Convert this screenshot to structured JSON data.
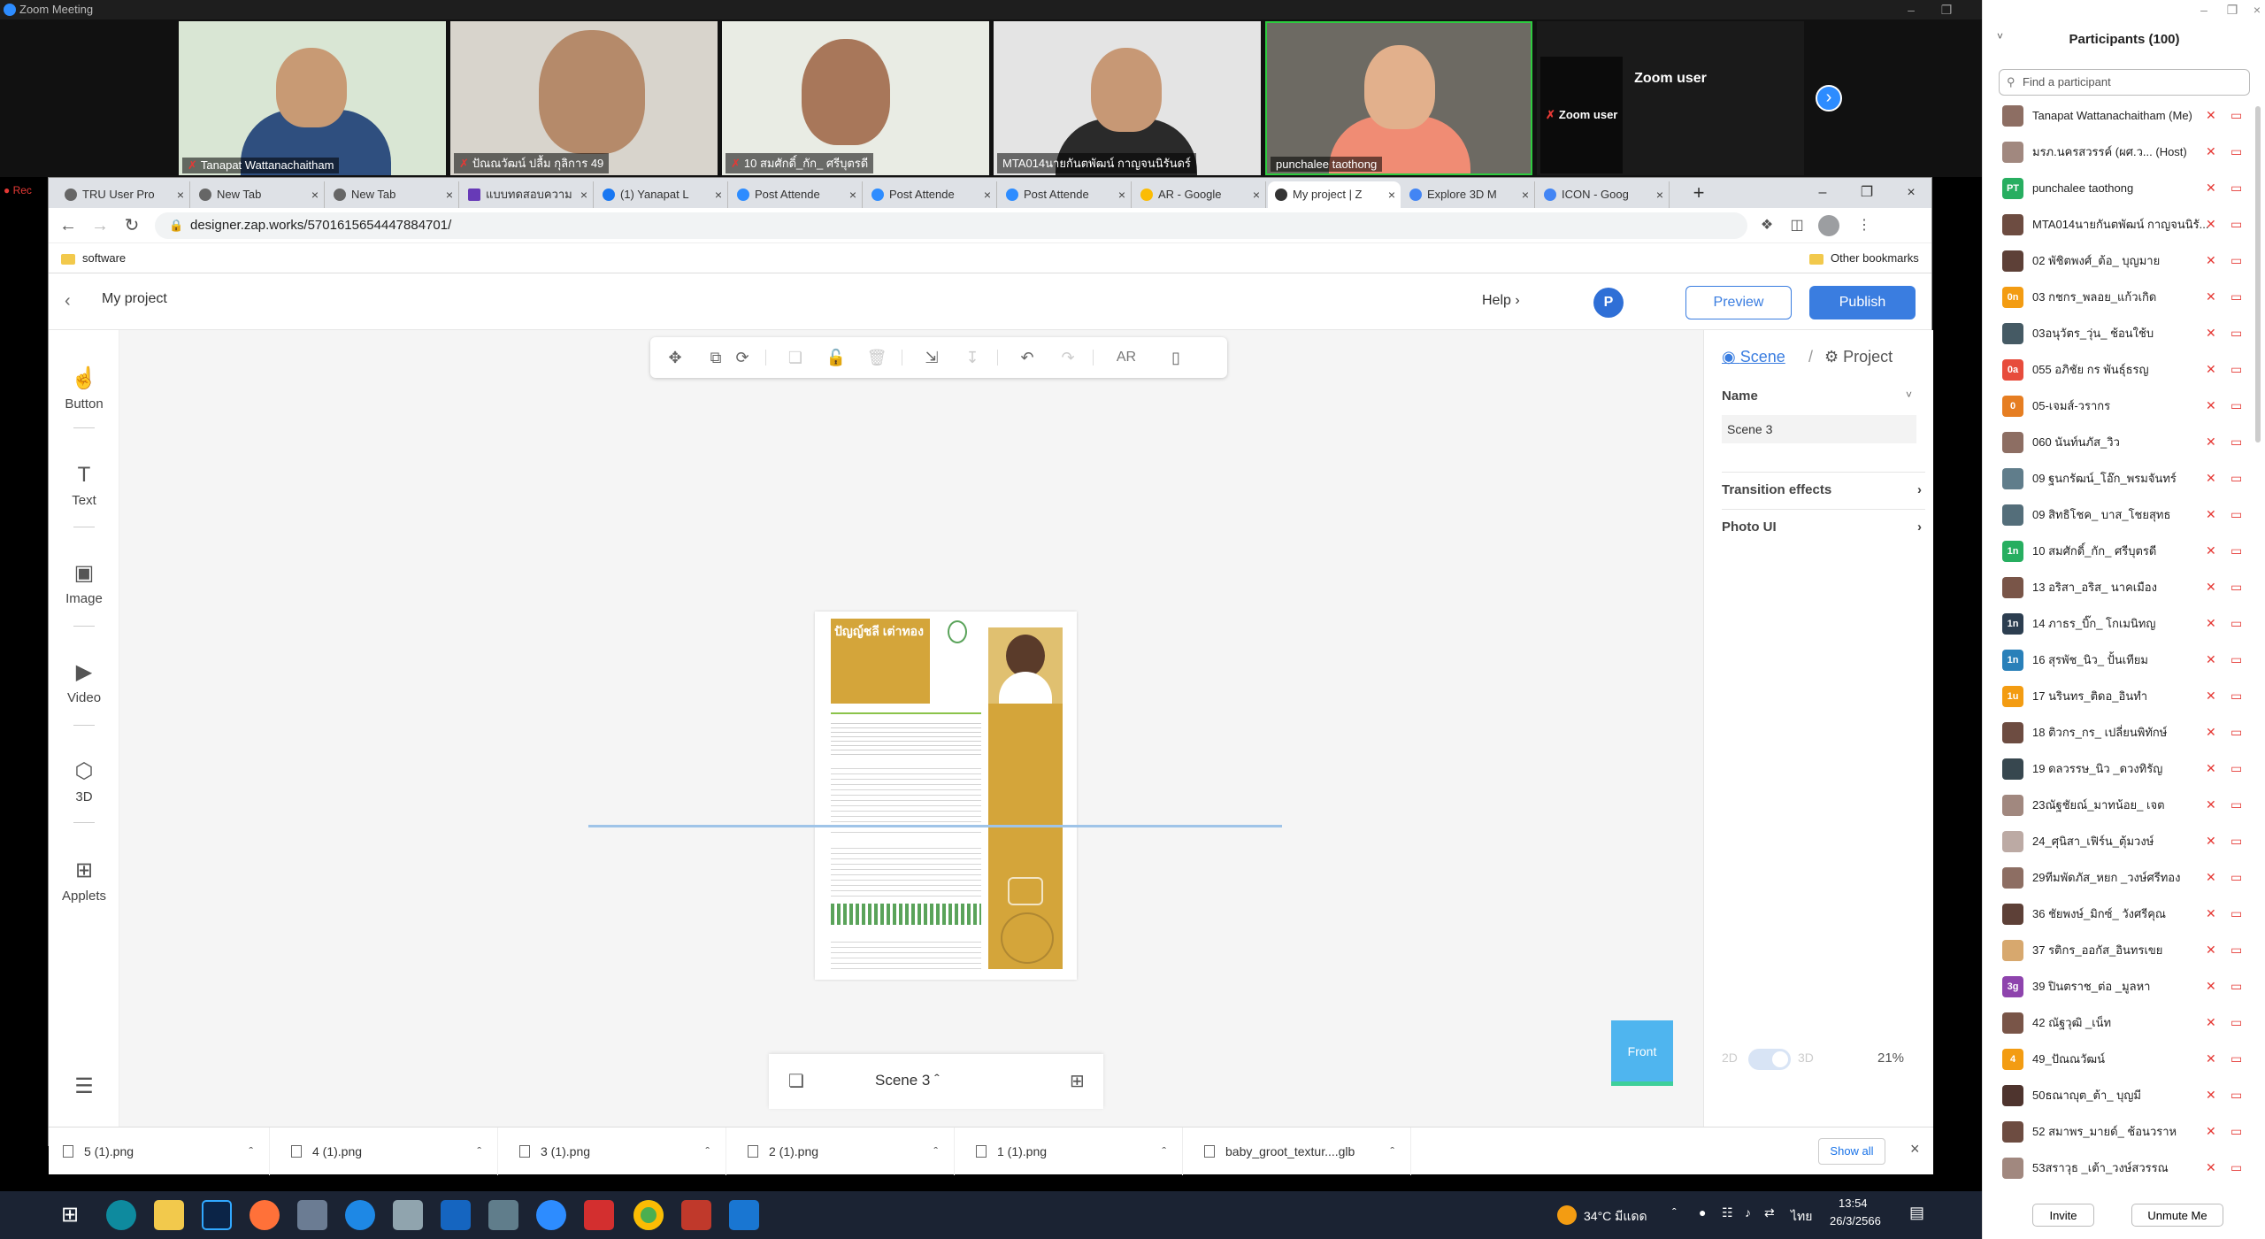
{
  "zoom": {
    "window_title": "Zoom Meeting",
    "recording_label": "Rec",
    "video_tiles": [
      {
        "name": "Tanapat Wattanachaitham"
      },
      {
        "name": "ปัณณวัฒน์ ปลื้ม กุลิการ 49"
      },
      {
        "name": "10 สมศักดิ์_กัก_ ศรีบุตรดี"
      },
      {
        "name": "MTA014นายกันตพัฒน์ กาญจนนิรันดร์"
      },
      {
        "name": "punchalee taothong"
      },
      {
        "name": "Zoom user"
      }
    ],
    "zoom_user_big": "Zoom user"
  },
  "browser": {
    "tabs": [
      {
        "label": "TRU User Pro"
      },
      {
        "label": "New Tab"
      },
      {
        "label": "New Tab"
      },
      {
        "label": "แบบทดสอบความ"
      },
      {
        "label": "(1) Yanapat L"
      },
      {
        "label": "Post Attende"
      },
      {
        "label": "Post Attende"
      },
      {
        "label": "Post Attende"
      },
      {
        "label": "AR - Google"
      },
      {
        "label": "My project | Z"
      },
      {
        "label": "Explore 3D M"
      },
      {
        "label": "ICON - Goog"
      }
    ],
    "url": "designer.zap.works/5701615654447884701/",
    "bookmarks": {
      "left": "software",
      "right": "Other bookmarks"
    }
  },
  "app": {
    "project_title": "My project",
    "help": "Help",
    "avatar_letter": "P",
    "preview": "Preview",
    "publish": "Publish",
    "rail": [
      {
        "label": "Button",
        "icon": "hand-pointer-icon"
      },
      {
        "label": "Text",
        "icon": "text-icon"
      },
      {
        "label": "Image",
        "icon": "image-icon"
      },
      {
        "label": "Video",
        "icon": "video-icon"
      },
      {
        "label": "3D",
        "icon": "cube-icon"
      },
      {
        "label": "Applets",
        "icon": "applets-icon"
      }
    ],
    "toolbar_ar": "AR",
    "scene_name": "Scene 3",
    "front_label": "Front",
    "resume_name": "ปัญญ์ชลี เต่าทอง",
    "right_panel": {
      "tab_scene": "Scene",
      "tab_project": "Project",
      "name_label": "Name",
      "name_value": "Scene 3",
      "transition": "Transition effects",
      "photo_ui": "Photo UI",
      "toggle_2d": "2D",
      "toggle_3d": "3D",
      "zoom": "21%"
    }
  },
  "downloads": {
    "items": [
      "5 (1).png",
      "4 (1).png",
      "3 (1).png",
      "2 (1).png",
      "1 (1).png",
      "baby_groot_textur....glb"
    ],
    "show_all": "Show all"
  },
  "taskbar": {
    "weather": "34°C มีแดด",
    "lang": "ไทย",
    "time": "13:54",
    "date": "26/3/2566"
  },
  "participants": {
    "header": "Participants (100)",
    "search_placeholder": "Find a participant",
    "list": [
      {
        "name": "Tanapat Wattanachaitham (Me)",
        "initial": "",
        "color": "#8d6e63"
      },
      {
        "name": "มรภ.นครสวรรค์ (ผศ.ว...   (Host)",
        "initial": "",
        "color": "#a1887f"
      },
      {
        "name": "punchalee taothong",
        "initial": "PT",
        "color": "#27ae60"
      },
      {
        "name": "MTA014นายกันตพัฒน์ กาญจนนิรั...",
        "initial": "",
        "color": "#6d4c41"
      },
      {
        "name": "02 พัชิตพงศ์_ต้อ_ บุญมาย",
        "initial": "",
        "color": "#5d4037"
      },
      {
        "name": "03 กชกร_พลอย_แก้วเกิด",
        "initial": "0n",
        "color": "#f39c12"
      },
      {
        "name": "03อนุวัตร_วุ่น_ ช้อนใช้บ",
        "initial": "",
        "color": "#455a64"
      },
      {
        "name": "055 อภิชัย กร พันธุ์ธรญ",
        "initial": "0a",
        "color": "#e74c3c"
      },
      {
        "name": "05-เจมส์-วรากร",
        "initial": "0",
        "color": "#e67e22"
      },
      {
        "name": "060 นันท์นภัส_วิว",
        "initial": "",
        "color": "#8d6e63"
      },
      {
        "name": "09 ฐนกรัฒน์_โอ๊ก_พรมจันทร์",
        "initial": "",
        "color": "#607d8b"
      },
      {
        "name": "09 สิทธิโชค_ บาส_โชยสุทธ",
        "initial": "",
        "color": "#546e7a"
      },
      {
        "name": "10 สมศักดิ์_กัก_ ศรีบุตรดี",
        "initial": "1n",
        "color": "#27ae60"
      },
      {
        "name": "13 อริสา_อริส_ นาคเมือง",
        "initial": "",
        "color": "#795548"
      },
      {
        "name": "14 ภาธร_บิ๊ก_ โกเมนิทญ",
        "initial": "1n",
        "color": "#2c3e50"
      },
      {
        "name": "16 สุรพัช_นิว_ ปั้นเทียม",
        "initial": "1n",
        "color": "#2980b9"
      },
      {
        "name": "17 นรินทร_ติดอ_อินทำ",
        "initial": "1u",
        "color": "#f39c12"
      },
      {
        "name": "18 ติวกร_กร_ เปลี่ยนพิทักษ์",
        "initial": "",
        "color": "#6d4c41"
      },
      {
        "name": "19 ดลวรรษ_นิว _ดวงทิรัญ",
        "initial": "",
        "color": "#37474f"
      },
      {
        "name": "23ณัฐชัยณ์_มาทน้อย_ เจต",
        "initial": "",
        "color": "#a1887f"
      },
      {
        "name": "24_ศุนิสา_เฟิร์น_ตุ้มวงษ์",
        "initial": "",
        "color": "#bcaaa4"
      },
      {
        "name": "29ทีมพัดภัส_หยก _วงษ์ศรีทอง",
        "initial": "",
        "color": "#8d6e63"
      },
      {
        "name": "36 ชัยพงษ์_มิกซ์_ วังศรีคุณ",
        "initial": "",
        "color": "#5d4037"
      },
      {
        "name": "37 รติกร_ออกัส_อินทรเขย",
        "initial": "",
        "color": "#d7a86e"
      },
      {
        "name": "39 ปินตราช_ต่อ _มูลหา",
        "initial": "3g",
        "color": "#8e44ad"
      },
      {
        "name": "42 ณัฐวุฒิ _เน็ท",
        "initial": "",
        "color": "#795548"
      },
      {
        "name": "49_ปัณณวัฒน์",
        "initial": "4",
        "color": "#f39c12"
      },
      {
        "name": "50ธณาญุต_ต้า_ บุญมี",
        "initial": "",
        "color": "#4e342e"
      },
      {
        "name": "52 สมาพร_มายด์_ ช้อนวราห",
        "initial": "",
        "color": "#6d4c41"
      },
      {
        "name": "53สราวุธ _เต้า_วงษ์สวรรณ",
        "initial": "",
        "color": "#a1887f"
      }
    ],
    "invite": "Invite",
    "unmute": "Unmute Me"
  }
}
